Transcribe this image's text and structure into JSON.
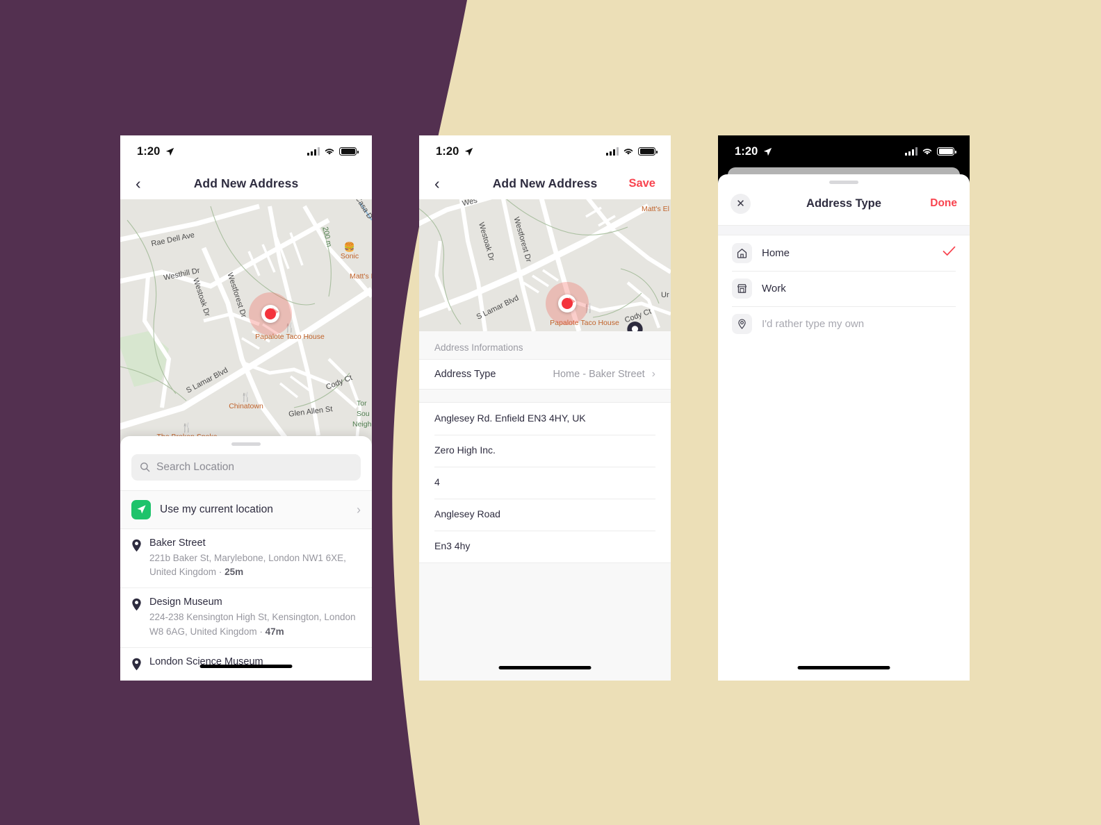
{
  "theme": {
    "bg_purple": "#533050",
    "bg_cream": "#ecdfb7",
    "accent_red": "#f8444f",
    "map_dot_red": "#f4333c",
    "pin_navy": "#2e2c3f",
    "green_badge": "#1ec36b"
  },
  "status_bar": {
    "time": "1:20",
    "location_arrow": "location-arrow-icon",
    "cellular": "cellular-bars-icon",
    "wifi": "wifi-icon",
    "battery": "battery-icon"
  },
  "screen1": {
    "nav": {
      "back": "chevron-left-icon",
      "title": "Add New Address"
    },
    "search": {
      "placeholder": "Search Location",
      "value": "",
      "icon": "search-icon"
    },
    "current_location": {
      "label": "Use my current location",
      "icon": "navigation-arrow-icon",
      "chevron": "chevron-right-icon"
    },
    "places": [
      {
        "name": "Baker Street",
        "address": "221b Baker St, Marylebone, London NW1 6XE, United Kingdom · ",
        "distance": "25m"
      },
      {
        "name": "Design Museum",
        "address": "224-238 Kensington High St, Kensington, London W8 6AG, United Kingdom · ",
        "distance": "47m"
      },
      {
        "name": "London Science Museum",
        "address": "",
        "distance": ""
      }
    ],
    "map": {
      "streets": [
        "Rae Dell Ave",
        "Westhill Dr",
        "Westoak Dr",
        "Westforest Dr",
        "S Lamar Blvd",
        "Cody Ct",
        "Glen Allen St",
        "Casa D",
        "200 m"
      ],
      "pois": [
        "Sonic",
        "Matt's El",
        "Papalote Taco House",
        "Chinatown",
        "The Broken Spoke"
      ],
      "green_labels": [
        "Tor",
        "Sou",
        "Neighb"
      ]
    }
  },
  "screen2": {
    "nav": {
      "back": "chevron-left-icon",
      "title": "Add New Address",
      "action": "Save"
    },
    "section_header": "Address Informations",
    "address_type": {
      "label": "Address Type",
      "value": "Home - Baker Street",
      "chevron": "chevron-right-icon"
    },
    "fields": [
      {
        "value": "Anglesey Rd. Enfield EN3 4HY, UK"
      },
      {
        "value": "Zero High Inc."
      },
      {
        "value": "4"
      },
      {
        "value": "Anglesey Road"
      },
      {
        "value": "En3 4hy"
      }
    ],
    "map": {
      "streets": [
        "Wes",
        "Westoak Dr",
        "Westforest Dr",
        "S Lamar Blvd",
        "Cody Ct",
        "Ur"
      ],
      "pois": [
        "Matt's El",
        "Papalote Taco House"
      ]
    }
  },
  "screen3": {
    "modal": {
      "close": "close-icon",
      "title": "Address Type",
      "done": "Done",
      "options": [
        {
          "label": "Home",
          "icon": "home-icon",
          "selected": true,
          "check": "check-icon"
        },
        {
          "label": "Work",
          "icon": "store-icon",
          "selected": false
        },
        {
          "label": "I'd rather type my own",
          "icon": "map-pin-icon",
          "selected": false,
          "muted": true
        }
      ]
    }
  }
}
